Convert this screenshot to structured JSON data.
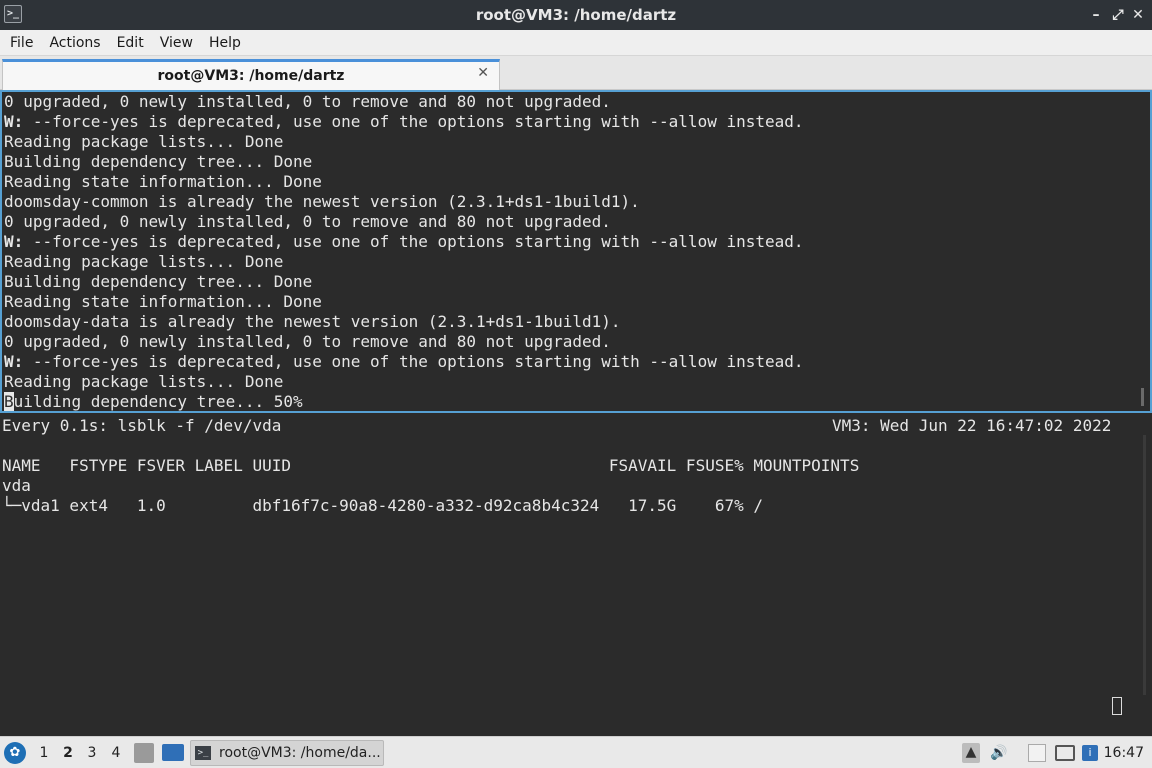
{
  "window": {
    "title": "root@VM3: /home/dartz",
    "icon": "terminal-icon",
    "controls": [
      "–",
      "⤢",
      "✕"
    ]
  },
  "menu": [
    "File",
    "Actions",
    "Edit",
    "View",
    "Help"
  ],
  "tab": {
    "label": "root@VM3: /home/dartz",
    "close": "✕"
  },
  "top_pane": {
    "lines": [
      "0 upgraded, 0 newly installed, 0 to remove and 80 not upgraded.",
      "W: --force-yes is deprecated, use one of the options starting with --allow instead.",
      "Reading package lists... Done",
      "Building dependency tree... Done",
      "Reading state information... Done",
      "doomsday-common is already the newest version (2.3.1+ds1-1build1).",
      "0 upgraded, 0 newly installed, 0 to remove and 80 not upgraded.",
      "W: --force-yes is deprecated, use one of the options starting with --allow instead.",
      "Reading package lists... Done",
      "Building dependency tree... Done",
      "Reading state information... Done",
      "doomsday-data is already the newest version (2.3.1+ds1-1build1).",
      "0 upgraded, 0 newly installed, 0 to remove and 80 not upgraded.",
      "W: --force-yes is deprecated, use one of the options starting with --allow instead.",
      "Reading package lists... Done"
    ],
    "last_line_cursor": "B",
    "last_line_rest": "uilding dependency tree... 50%"
  },
  "bottom_pane": {
    "watch_header": "Every 0.1s: lsblk -f /dev/vda",
    "watch_status": "VM3: Wed Jun 22 16:47:02 2022",
    "table_header": "NAME   FSTYPE FSVER LABEL UUID                                 FSAVAIL FSUSE% MOUNTPOINTS",
    "rows": [
      "vda",
      "└─vda1 ext4   1.0         dbf16f7c-90a8-4280-a332-d92ca8b4c324   17.5G    67% /"
    ]
  },
  "taskbar": {
    "start_icon": "distro-logo-icon",
    "workspaces": [
      "1",
      "2",
      "3",
      "4"
    ],
    "active_workspace": "2",
    "task": "root@VM3: /home/da...",
    "clock": "16:47"
  }
}
